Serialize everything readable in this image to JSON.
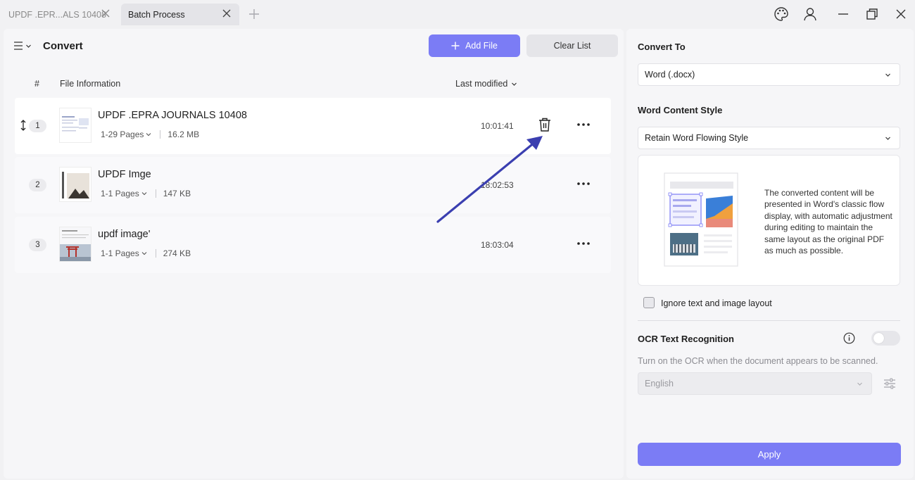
{
  "tabs": [
    {
      "label": "UPDF .EPR...ALS 10408",
      "active": false
    },
    {
      "label": "Batch Process",
      "active": true
    }
  ],
  "header": {
    "title": "Convert",
    "add_file_label": "Add File",
    "clear_list_label": "Clear List"
  },
  "columns": {
    "index": "#",
    "file_info": "File Information",
    "last_modified": "Last modified"
  },
  "files": [
    {
      "index": "1",
      "name": "UPDF .EPRA JOURNALS 10408",
      "pages": "1-29 Pages",
      "size": "16.2 MB",
      "time": "10:01:41"
    },
    {
      "index": "2",
      "name": "UPDF Imge",
      "pages": "1-1 Pages",
      "size": "147 KB",
      "time": "18:02:53"
    },
    {
      "index": "3",
      "name": "updf image'",
      "pages": "1-1 Pages",
      "size": "274 KB",
      "time": "18:03:04"
    }
  ],
  "settings": {
    "convert_to_label": "Convert To",
    "convert_to_value": "Word (.docx)",
    "content_style_label": "Word Content Style",
    "content_style_value": "Retain Word Flowing Style",
    "style_description": "The converted content will be presented in Word's classic flow display, with automatic adjustment during editing to maintain the same layout as the original PDF as much as possible.",
    "ignore_layout_label": "Ignore text and image layout",
    "ignore_layout_checked": false,
    "ocr_label": "OCR Text Recognition",
    "ocr_enabled": false,
    "ocr_hint": "Turn on the OCR when the document appears to be scanned.",
    "ocr_language": "English",
    "apply_label": "Apply"
  },
  "colors": {
    "accent": "#7b7cf5",
    "annotation_arrow": "#3b3fb0"
  }
}
